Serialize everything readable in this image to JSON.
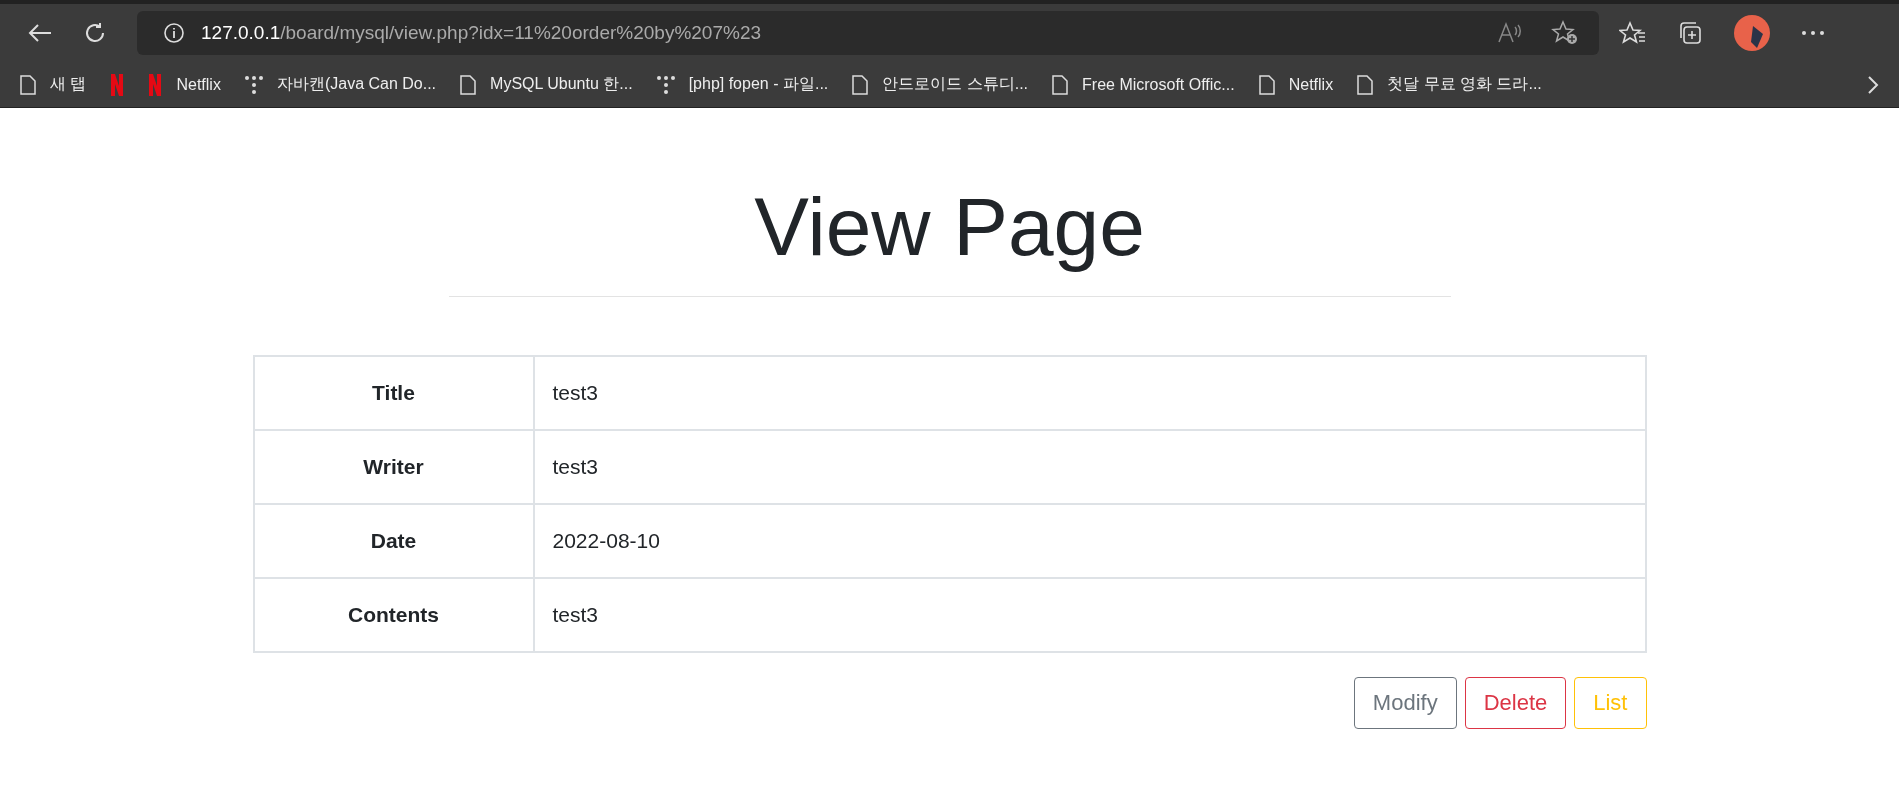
{
  "browser": {
    "address": {
      "host": "127.0.0.1",
      "path": "/board/mysql/view.php?idx=11%20order%20by%207%23"
    },
    "bookmarks": [
      {
        "kind": "page",
        "label": "새 탭"
      },
      {
        "kind": "netflix"
      },
      {
        "kind": "netflix",
        "label": "Netflix"
      },
      {
        "kind": "dots",
        "label": "자바캔(Java Can Do..."
      },
      {
        "kind": "page",
        "label": "MySQL Ubuntu 한..."
      },
      {
        "kind": "dots",
        "label": "[php] fopen - 파일..."
      },
      {
        "kind": "page",
        "label": "안드로이드 스튜디..."
      },
      {
        "kind": "page",
        "label": "Free Microsoft Offic..."
      },
      {
        "kind": "page",
        "label": "Netflix"
      },
      {
        "kind": "page",
        "label": "첫달 무료 영화 드라..."
      }
    ]
  },
  "page": {
    "heading": "View Page",
    "rows": [
      {
        "label": "Title",
        "value": "test3"
      },
      {
        "label": "Writer",
        "value": "test3"
      },
      {
        "label": "Date",
        "value": "2022-08-10"
      },
      {
        "label": "Contents",
        "value": "test3"
      }
    ],
    "buttons": [
      {
        "label": "Modify",
        "color": "#6c757d"
      },
      {
        "label": "Delete",
        "color": "#dc3545"
      },
      {
        "label": "List",
        "color": "#ffc107"
      }
    ]
  }
}
